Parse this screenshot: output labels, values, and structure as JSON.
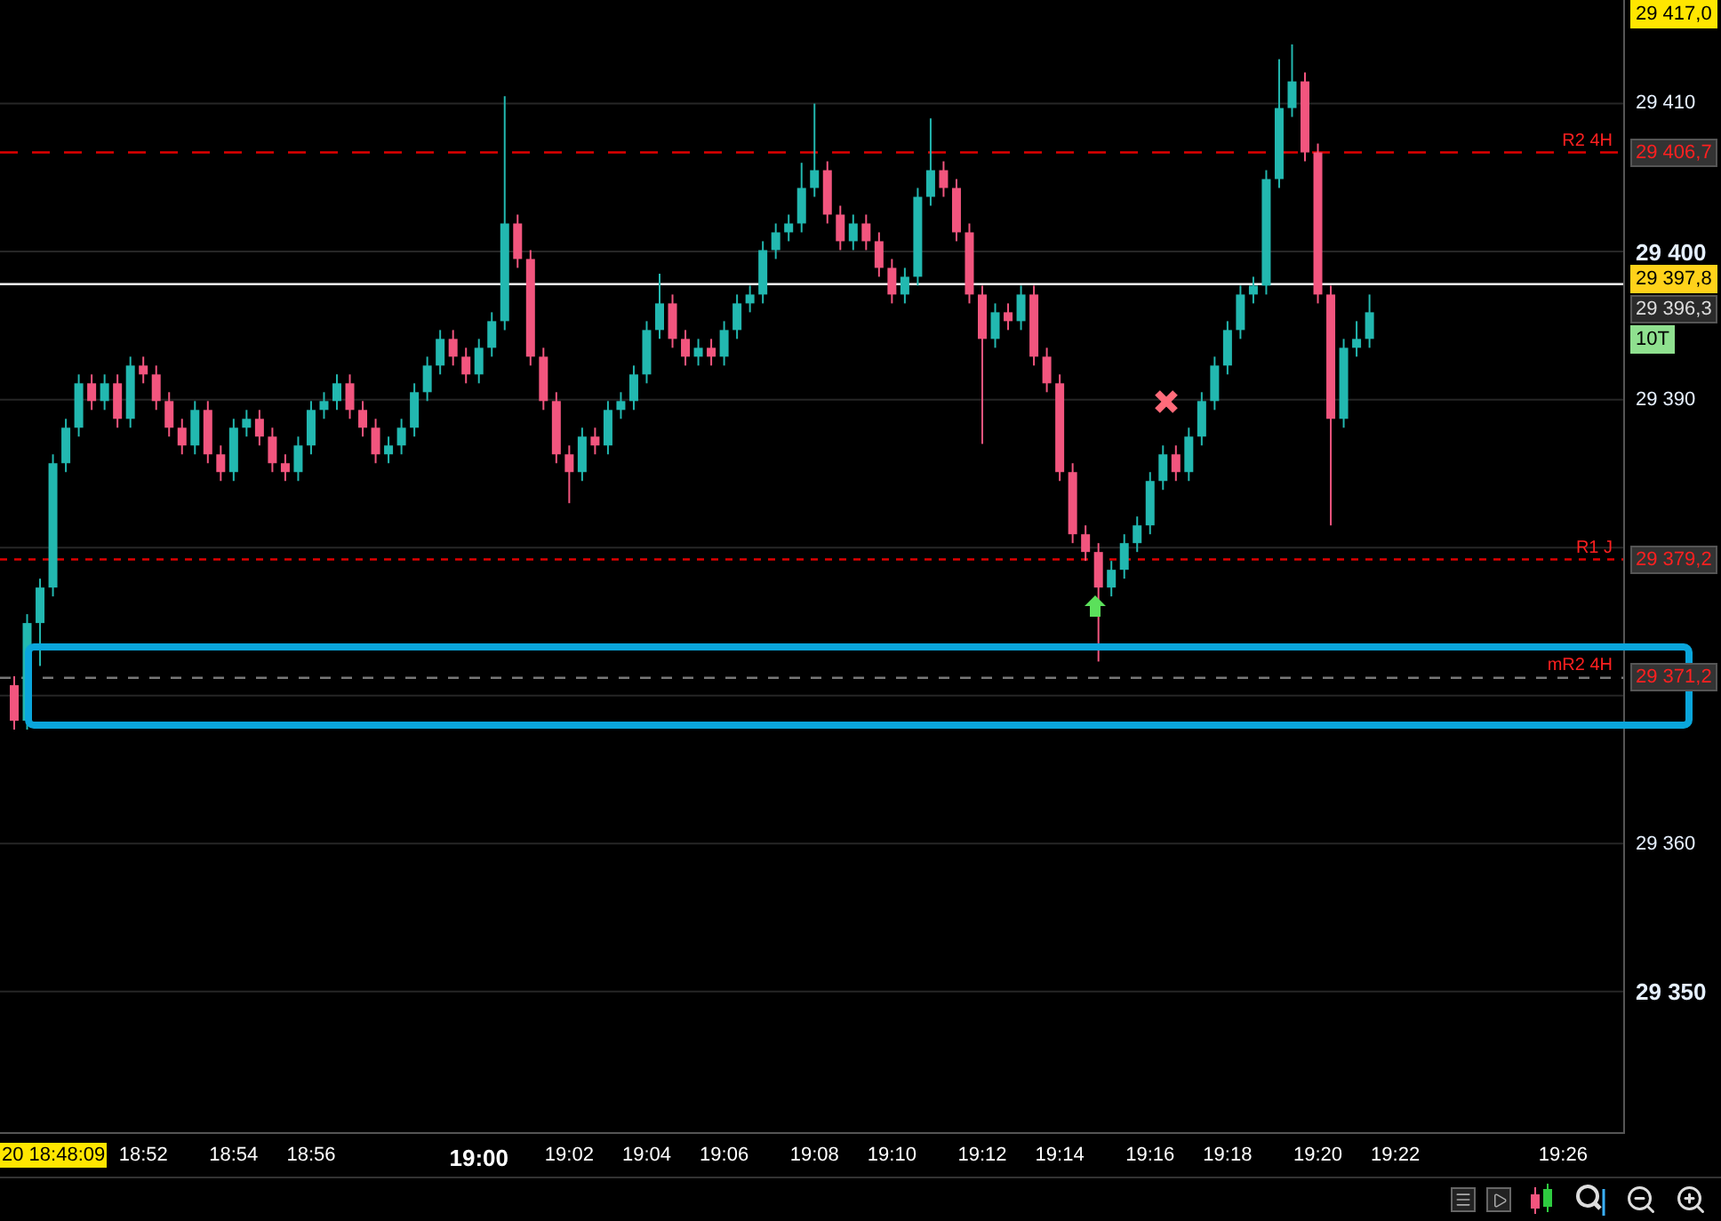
{
  "price_axis": {
    "top_price": "29 417,0"
  },
  "chart_data": {
    "type": "candlestick",
    "ylim": [
      29340.5,
      29417
    ],
    "grid": true,
    "categories": [
      null,
      null,
      null,
      null,
      null,
      null,
      null,
      null,
      null,
      null,
      "18:52",
      null,
      null,
      null,
      null,
      null,
      null,
      "18:54",
      null,
      null,
      null,
      null,
      null,
      "18:56",
      null,
      null,
      null,
      null,
      null,
      null,
      null,
      null,
      null,
      null,
      null,
      null,
      "19:00",
      null,
      null,
      null,
      null,
      null,
      null,
      "19:02",
      null,
      null,
      null,
      null,
      null,
      "19:04",
      null,
      null,
      null,
      null,
      null,
      "19:06",
      null,
      null,
      null,
      null,
      null,
      null,
      "19:08",
      null,
      null,
      null,
      null,
      null,
      "19:10",
      null,
      null,
      null,
      null,
      null,
      null,
      "19:12",
      null,
      null,
      null,
      null,
      null,
      "19:14",
      null,
      null,
      null,
      null,
      null,
      null,
      "19:16",
      null,
      null,
      null,
      null,
      null,
      "19:18",
      null,
      null,
      null,
      null,
      null,
      null,
      "19:20",
      null,
      null,
      null,
      null,
      null,
      "19:22",
      null,
      null,
      null,
      null,
      null,
      null,
      null,
      null,
      null,
      null,
      null,
      null,
      "19:26"
    ],
    "ref_lines": [
      {
        "axis": "y",
        "value": 29406.7
      },
      {
        "axis": "y",
        "value": 29379.2
      },
      {
        "axis": "y",
        "value": 29371.2
      },
      {
        "axis": "y",
        "value": 29397.8
      }
    ],
    "yticks": [
      {
        "value": 29410,
        "label": "29 410"
      },
      {
        "value": 29400,
        "label": "29 400"
      },
      {
        "value": 29390,
        "label": "29 390"
      },
      {
        "value": 29360,
        "label": "29 360"
      },
      {
        "value": 29350,
        "label": "29 350"
      }
    ],
    "ohlc": [
      [
        29370.7,
        29371.3,
        29367.7,
        29368.3
      ],
      [
        29368.3,
        29375.5,
        29367.7,
        29374.9
      ],
      [
        29374.9,
        29377.9,
        29372.0,
        29377.3
      ],
      [
        29377.3,
        29386.3,
        29376.7,
        29385.7
      ],
      [
        29385.7,
        29388.7,
        29385.1,
        29388.1
      ],
      [
        29388.1,
        29391.7,
        29387.5,
        29391.1
      ],
      [
        29391.1,
        29391.7,
        29389.3,
        29389.9
      ],
      [
        29389.9,
        29391.7,
        29389.3,
        29391.1
      ],
      [
        29391.1,
        29391.7,
        29388.1,
        29388.7
      ],
      [
        29388.7,
        29392.9,
        29388.1,
        29392.3
      ],
      [
        29392.3,
        29392.9,
        29391.1,
        29391.7
      ],
      [
        29391.7,
        29392.3,
        29389.3,
        29389.9
      ],
      [
        29389.9,
        29390.5,
        29387.5,
        29388.1
      ],
      [
        29388.1,
        29388.7,
        29386.3,
        29386.9
      ],
      [
        29386.9,
        29389.9,
        29386.3,
        29389.3
      ],
      [
        29389.3,
        29389.9,
        29385.7,
        29386.3
      ],
      [
        29386.3,
        29386.9,
        29384.5,
        29385.1
      ],
      [
        29385.1,
        29388.7,
        29384.5,
        29388.1
      ],
      [
        29388.1,
        29389.3,
        29387.5,
        29388.7
      ],
      [
        29388.7,
        29389.3,
        29386.9,
        29387.5
      ],
      [
        29387.5,
        29388.1,
        29385.1,
        29385.7
      ],
      [
        29385.7,
        29386.3,
        29384.5,
        29385.1
      ],
      [
        29385.1,
        29387.5,
        29384.5,
        29386.9
      ],
      [
        29386.9,
        29389.9,
        29386.3,
        29389.3
      ],
      [
        29389.3,
        29390.5,
        29388.7,
        29389.9
      ],
      [
        29389.9,
        29391.7,
        29389.3,
        29391.1
      ],
      [
        29391.1,
        29391.7,
        29388.7,
        29389.3
      ],
      [
        29389.3,
        29389.9,
        29387.5,
        29388.1
      ],
      [
        29388.1,
        29388.7,
        29385.7,
        29386.3
      ],
      [
        29386.3,
        29387.5,
        29385.7,
        29386.9
      ],
      [
        29386.9,
        29388.7,
        29386.3,
        29388.1
      ],
      [
        29388.1,
        29391.1,
        29387.5,
        29390.5
      ],
      [
        29390.5,
        29392.9,
        29389.9,
        29392.3
      ],
      [
        29392.3,
        29394.7,
        29391.7,
        29394.1
      ],
      [
        29394.1,
        29394.7,
        29392.3,
        29392.9
      ],
      [
        29392.9,
        29393.5,
        29391.1,
        29391.7
      ],
      [
        29391.7,
        29394.1,
        29391.1,
        29393.5
      ],
      [
        29393.5,
        29395.9,
        29392.9,
        29395.3
      ],
      [
        29395.3,
        29410.5,
        29394.7,
        29401.9
      ],
      [
        29401.9,
        29402.5,
        29398.9,
        29399.5
      ],
      [
        29399.5,
        29400.1,
        29392.3,
        29392.9
      ],
      [
        29392.9,
        29393.5,
        29389.3,
        29389.9
      ],
      [
        29389.9,
        29390.5,
        29385.7,
        29386.3
      ],
      [
        29386.3,
        29386.9,
        29383.0,
        29385.1
      ],
      [
        29385.1,
        29388.1,
        29384.5,
        29387.5
      ],
      [
        29387.5,
        29388.1,
        29386.3,
        29386.9
      ],
      [
        29386.9,
        29389.9,
        29386.3,
        29389.3
      ],
      [
        29389.3,
        29390.5,
        29388.7,
        29389.9
      ],
      [
        29389.9,
        29392.3,
        29389.3,
        29391.7
      ],
      [
        29391.7,
        29395.3,
        29391.1,
        29394.7
      ],
      [
        29394.7,
        29398.5,
        29394.1,
        29396.5
      ],
      [
        29396.5,
        29397.1,
        29393.5,
        29394.1
      ],
      [
        29394.1,
        29394.7,
        29392.3,
        29392.9
      ],
      [
        29392.9,
        29394.1,
        29392.3,
        29393.5
      ],
      [
        29393.5,
        29394.1,
        29392.3,
        29392.9
      ],
      [
        29392.9,
        29395.3,
        29392.3,
        29394.7
      ],
      [
        29394.7,
        29397.1,
        29394.1,
        29396.5
      ],
      [
        29396.5,
        29397.7,
        29395.9,
        29397.1
      ],
      [
        29397.1,
        29400.7,
        29396.5,
        29400.1
      ],
      [
        29400.1,
        29401.9,
        29399.5,
        29401.3
      ],
      [
        29401.3,
        29402.5,
        29400.7,
        29401.9
      ],
      [
        29401.9,
        29406.0,
        29401.3,
        29404.3
      ],
      [
        29404.3,
        29410.0,
        29403.7,
        29405.5
      ],
      [
        29405.5,
        29406.1,
        29401.9,
        29402.5
      ],
      [
        29402.5,
        29403.1,
        29400.1,
        29400.7
      ],
      [
        29400.7,
        29402.5,
        29400.1,
        29401.9
      ],
      [
        29401.9,
        29402.5,
        29400.1,
        29400.7
      ],
      [
        29400.7,
        29401.3,
        29398.3,
        29398.9
      ],
      [
        29398.9,
        29399.5,
        29396.5,
        29397.1
      ],
      [
        29397.1,
        29398.9,
        29396.5,
        29398.3
      ],
      [
        29398.3,
        29404.3,
        29397.7,
        29403.7
      ],
      [
        29403.7,
        29409.0,
        29403.1,
        29405.5
      ],
      [
        29405.5,
        29406.1,
        29403.7,
        29404.3
      ],
      [
        29404.3,
        29404.9,
        29400.7,
        29401.3
      ],
      [
        29401.3,
        29401.9,
        29396.5,
        29397.1
      ],
      [
        29397.1,
        29397.7,
        29387.0,
        29394.1
      ],
      [
        29394.1,
        29396.5,
        29393.5,
        29395.9
      ],
      [
        29395.9,
        29396.5,
        29394.7,
        29395.3
      ],
      [
        29395.3,
        29397.7,
        29394.7,
        29397.1
      ],
      [
        29397.1,
        29397.7,
        29392.3,
        29392.9
      ],
      [
        29392.9,
        29393.5,
        29390.5,
        29391.1
      ],
      [
        29391.1,
        29391.7,
        29384.5,
        29385.1
      ],
      [
        29385.1,
        29385.7,
        29380.3,
        29380.9
      ],
      [
        29380.9,
        29381.5,
        29379.1,
        29379.7
      ],
      [
        29379.7,
        29380.3,
        29372.3,
        29377.3
      ],
      [
        29377.3,
        29379.1,
        29376.7,
        29378.5
      ],
      [
        29378.5,
        29380.9,
        29377.9,
        29380.3
      ],
      [
        29380.3,
        29382.1,
        29379.7,
        29381.5
      ],
      [
        29381.5,
        29385.1,
        29380.9,
        29384.5
      ],
      [
        29384.5,
        29386.9,
        29383.9,
        29386.3
      ],
      [
        29386.3,
        29386.9,
        29384.5,
        29385.1
      ],
      [
        29385.1,
        29388.1,
        29384.5,
        29387.5
      ],
      [
        29387.5,
        29390.5,
        29386.9,
        29389.9
      ],
      [
        29389.9,
        29392.9,
        29389.3,
        29392.3
      ],
      [
        29392.3,
        29395.3,
        29391.7,
        29394.7
      ],
      [
        29394.7,
        29397.7,
        29394.1,
        29397.1
      ],
      [
        29397.1,
        29398.3,
        29396.5,
        29397.7
      ],
      [
        29397.7,
        29405.5,
        29397.1,
        29404.9
      ],
      [
        29404.9,
        29413.0,
        29404.3,
        29409.7
      ],
      [
        29409.7,
        29414.0,
        29409.1,
        29411.5
      ],
      [
        29411.5,
        29412.1,
        29406.1,
        29406.7
      ],
      [
        29406.7,
        29407.3,
        29396.5,
        29397.1
      ],
      [
        29397.1,
        29397.7,
        29381.5,
        29388.7
      ],
      [
        29388.7,
        29394.1,
        29388.1,
        29393.5
      ],
      [
        29393.5,
        29395.3,
        29392.9,
        29394.1
      ],
      [
        29394.1,
        29397.1,
        29393.5,
        29395.9
      ],
      null,
      null,
      null,
      null,
      null,
      null,
      null,
      null,
      null,
      null,
      null,
      null,
      null,
      null,
      null
    ]
  },
  "price_levels": [
    {
      "label": "R2 4H",
      "value": "29 406,7"
    },
    {
      "label": "R1 J",
      "value": "29 379,2"
    },
    {
      "label": "mR2 4H",
      "value": "29 371,2"
    }
  ],
  "last_price": "29 397,8",
  "bid_price": "29 396,3",
  "interval_badge": "10T",
  "markers": [
    {
      "kind": "exit"
    },
    {
      "kind": "buy"
    }
  ],
  "time_axis": {
    "cursor_time": "20 18:48:09",
    "ticks_bold": [
      false,
      false,
      false,
      true,
      false,
      false,
      false,
      false,
      false,
      false,
      false,
      false,
      false,
      false,
      false,
      false
    ]
  }
}
